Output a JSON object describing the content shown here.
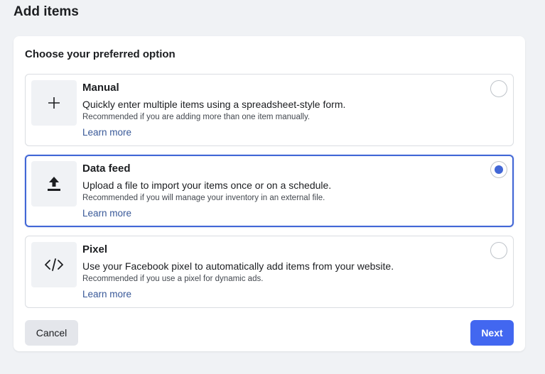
{
  "page": {
    "title": "Add items"
  },
  "card": {
    "heading": "Choose your preferred option"
  },
  "options": [
    {
      "title": "Manual",
      "description": "Quickly enter multiple items using a spreadsheet-style form.",
      "recommendation": "Recommended if you are adding more than one item manually.",
      "link": "Learn more",
      "icon": "plus-icon",
      "selected": false
    },
    {
      "title": "Data feed",
      "description": "Upload a file to import your items once or on a schedule.",
      "recommendation": "Recommended if you will manage your inventory in an external file.",
      "link": "Learn more",
      "icon": "upload-icon",
      "selected": true
    },
    {
      "title": "Pixel",
      "description": "Use your Facebook pixel to automatically add items from your website.",
      "recommendation": "Recommended if you use a pixel for dynamic ads.",
      "link": "Learn more",
      "icon": "code-icon",
      "selected": false
    }
  ],
  "footer": {
    "cancel_label": "Cancel",
    "next_label": "Next"
  },
  "colors": {
    "accent": "#4267f0",
    "link": "#385898",
    "background": "#f0f2f5"
  }
}
